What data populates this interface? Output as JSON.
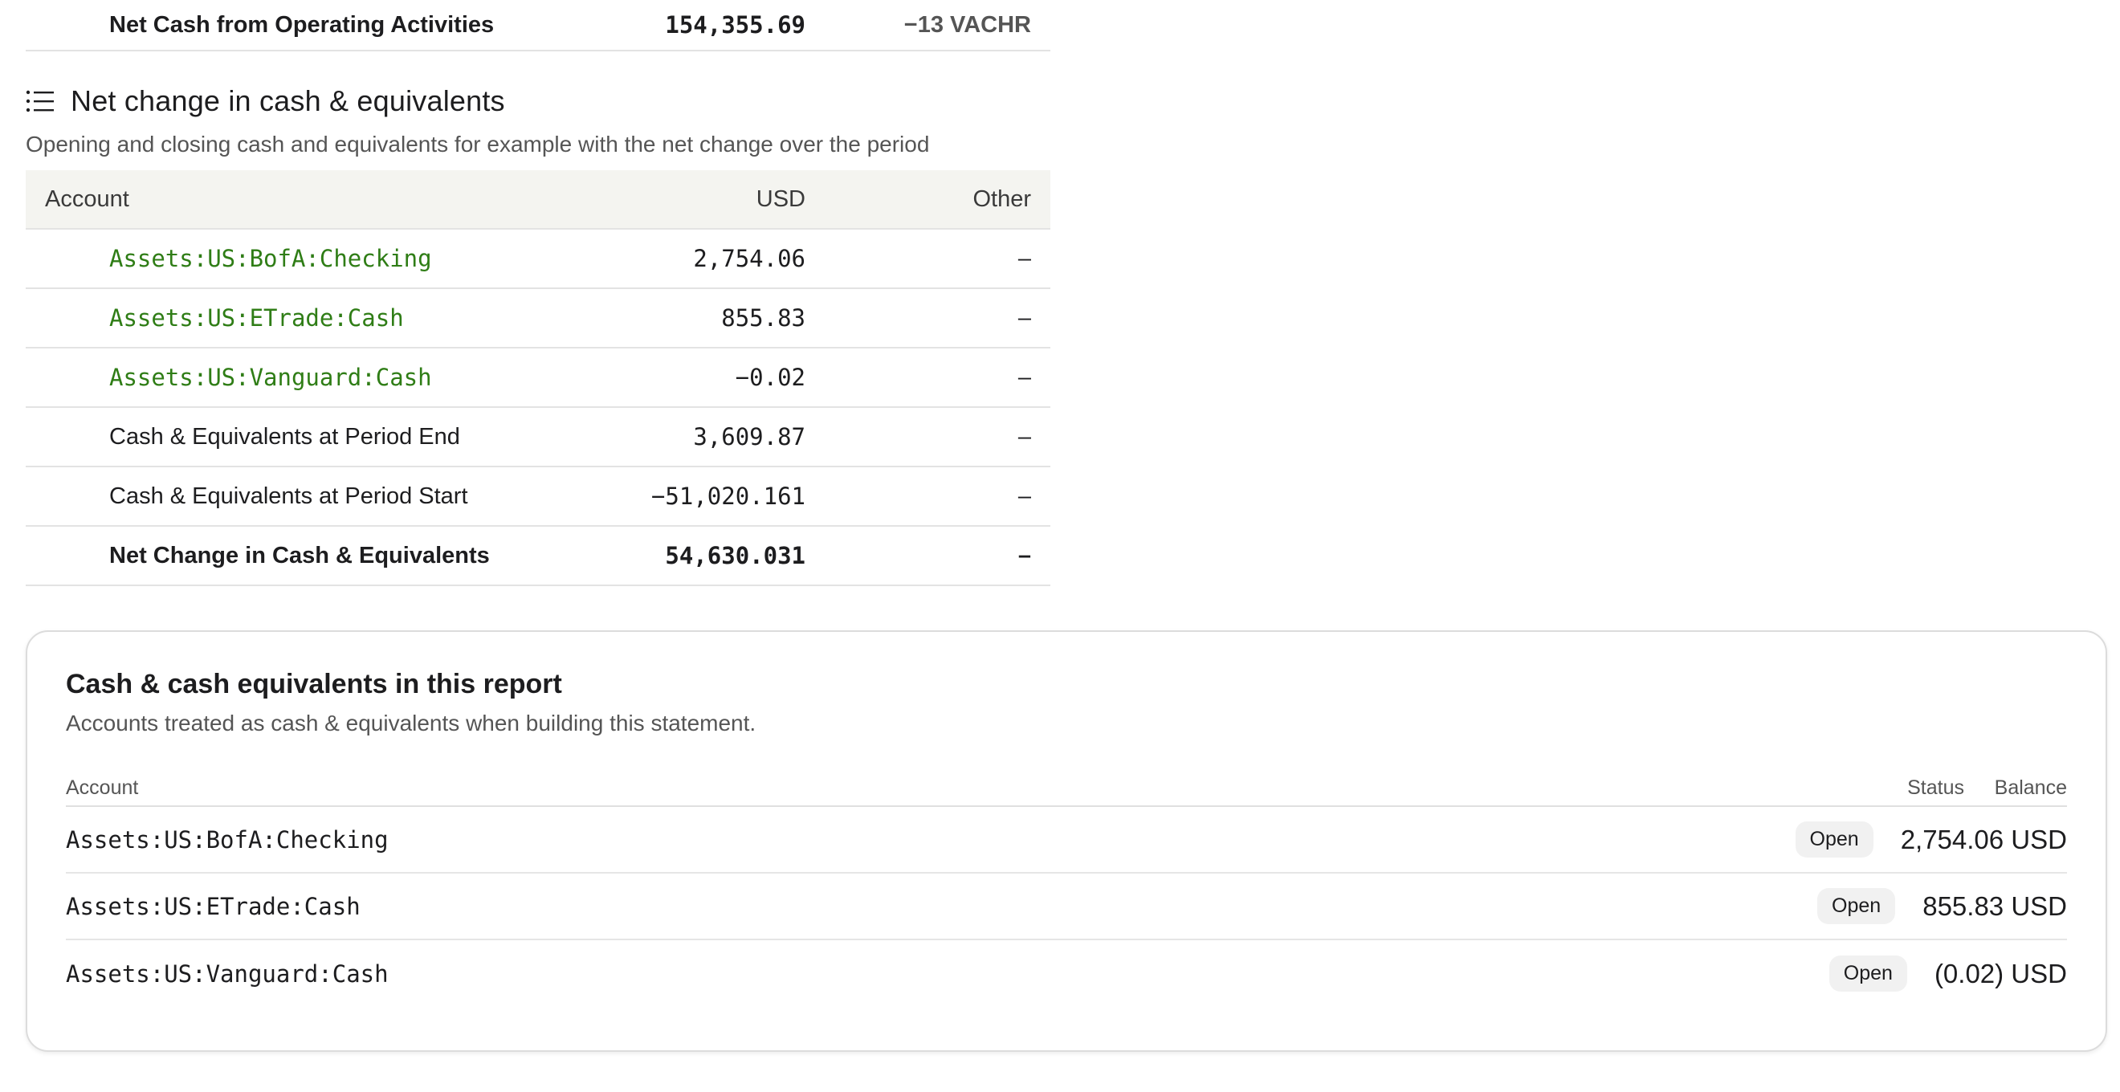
{
  "operating_total": {
    "label": "Net Cash from Operating Activities",
    "usd": "154,355.69",
    "other": "−13 VACHR"
  },
  "net_change": {
    "title": "Net change in cash & equivalents",
    "description": "Opening and closing cash and equivalents for example with the net change over the period",
    "columns": {
      "account": "Account",
      "usd": "USD",
      "other": "Other"
    },
    "rows": [
      {
        "account": "Assets:US:BofA:Checking",
        "usd": "2,754.06",
        "other": "–",
        "link": true
      },
      {
        "account": "Assets:US:ETrade:Cash",
        "usd": "855.83",
        "other": "–",
        "link": true
      },
      {
        "account": "Assets:US:Vanguard:Cash",
        "usd": "−0.02",
        "other": "–",
        "link": true
      },
      {
        "account": "Cash & Equivalents at Period End",
        "usd": "3,609.87",
        "other": "–"
      },
      {
        "account": "Cash & Equivalents at Period Start",
        "usd": "−51,020.161",
        "other": "–"
      }
    ],
    "total": {
      "account": "Net Change in Cash & Equivalents",
      "usd": "54,630.031",
      "other": "–"
    }
  },
  "cash_card": {
    "title": "Cash & cash equivalents in this report",
    "description": "Accounts treated as cash & equivalents when building this statement.",
    "columns": {
      "account": "Account",
      "status": "Status",
      "balance": "Balance"
    },
    "rows": [
      {
        "account": "Assets:US:BofA:Checking",
        "status": "Open",
        "balance": "2,754.06 USD"
      },
      {
        "account": "Assets:US:ETrade:Cash",
        "status": "Open",
        "balance": "855.83 USD"
      },
      {
        "account": "Assets:US:Vanguard:Cash",
        "status": "Open",
        "balance": "(0.02) USD"
      }
    ]
  },
  "colors": {
    "account_link": "#2f7d16",
    "header_bg": "#f4f4f0",
    "badge_bg": "#f1f1f1"
  }
}
